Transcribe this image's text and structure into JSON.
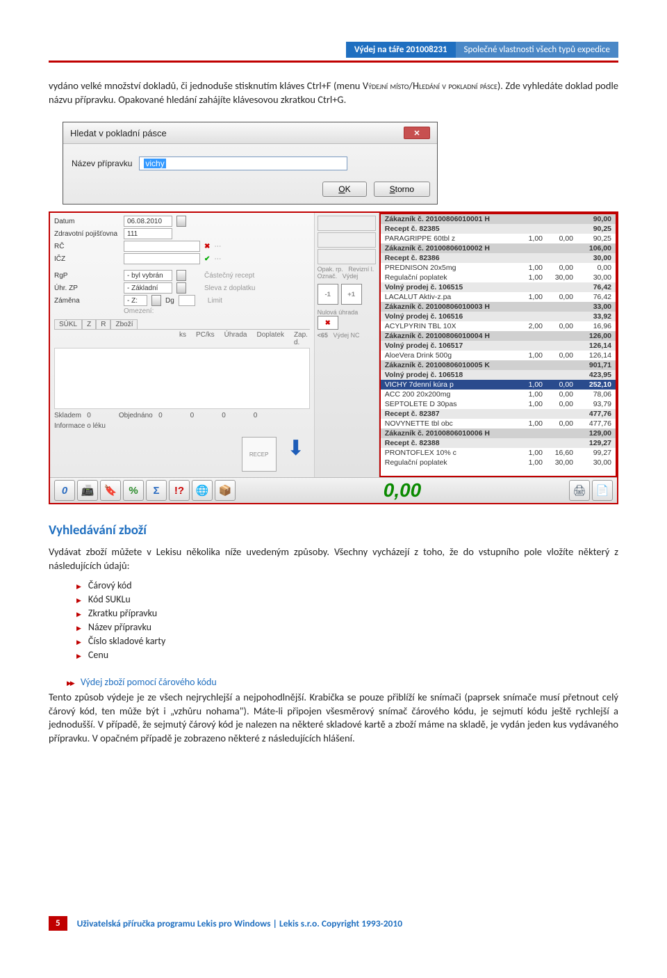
{
  "header": {
    "tag": "Výdej na táře 201008231",
    "sub": "Společné vlastnosti všech typů expedice"
  },
  "para1_a": "vydáno velké množství dokladů, či jednoduše stisknutím kláves Ctrl+F (menu ",
  "para1_sc": "Výdejní místo/Hledání v pokladní pásce",
  "para1_b": "). Zde vyhledáte doklad podle názvu přípravku. Opakované hledání zahájíte klávesovou zkratkou Ctrl+G.",
  "dialog": {
    "title": "Hledat v pokladní pásce",
    "label": "Název přípravku",
    "value": "vichy",
    "ok": "OK",
    "cancel": "Storno"
  },
  "pos": {
    "left": {
      "datum_lbl": "Datum",
      "datum_val": "06.08.2010",
      "zp_lbl": "Zdravotní pojišťovna",
      "zp_val": "111",
      "rc_lbl": "RČ",
      "icz_lbl": "IČZ",
      "rgp_lbl": "RgP",
      "rgp_val": "- byl vybrán",
      "uhr_lbl": "Úhr. ZP",
      "uhr_val": "- Základní",
      "zam_lbl": "Záměna",
      "zam_val": "- Z:",
      "dg_lbl": "Dg",
      "rec_lbl": "Částečný recept",
      "opak_lbl": "Opak. rp.",
      "rev_lbl": "Revizní l.",
      "sleva_lbl": "Sleva z doplatku",
      "ozn_lbl": "Označ.",
      "vyd_lbl": "Výdej",
      "limit_lbl": "Limit",
      "nul_lbl": "Nulová úhrada",
      "omez_lbl": "Omezení:",
      "lt65": "<65",
      "ncv": "Výdej NC",
      "tab_sukl": "SÚKL",
      "tab_z": "Z",
      "tab_r": "R",
      "tab_zbozi": "Zboží",
      "col_ks": "ks",
      "col_pcks": "PC/ks",
      "col_uhr": "Úhrada",
      "col_dop": "Doplatek",
      "col_zap": "Zap. d.",
      "skl_lbl": "Skladem",
      "skl_v": "0",
      "obj_lbl": "Objednáno",
      "obj_v": "0",
      "info_lbl": "Informace o léku",
      "z1": "0",
      "z2": "0",
      "z3": "0"
    },
    "right_rows": [
      {
        "t": "hdr",
        "name": "Zákazník č. 20100806010001 H",
        "amt": "90,00"
      },
      {
        "t": "sub",
        "name": "Recept č. 82385",
        "amt": "90,25"
      },
      {
        "t": "row",
        "name": "PARAGRIPPE 60tbl z",
        "c": "1,00",
        "c2": "0,00",
        "amt": "90,25"
      },
      {
        "t": "hdr",
        "name": "Zákazník č. 20100806010002 H",
        "amt": "106,00"
      },
      {
        "t": "sub",
        "name": "Recept č. 82386",
        "amt": "30,00"
      },
      {
        "t": "row",
        "name": "PREDNISON 20x5mg",
        "c": "1,00",
        "c2": "0,00",
        "amt": "0,00"
      },
      {
        "t": "row",
        "name": "Regulační poplatek",
        "c": "1,00",
        "c2": "30,00",
        "amt": "30,00"
      },
      {
        "t": "sub",
        "name": "Volný prodej č. 106515",
        "amt": "76,42"
      },
      {
        "t": "row",
        "name": "LACALUT Aktiv-z.pa",
        "c": "1,00",
        "c2": "0,00",
        "amt": "76,42"
      },
      {
        "t": "hdr",
        "name": "Zákazník č. 20100806010003 H",
        "amt": "33,00"
      },
      {
        "t": "sub",
        "name": "Volný prodej č. 106516",
        "amt": "33,92"
      },
      {
        "t": "row",
        "name": "ACYLPYRIN TBL 10X",
        "c": "2,00",
        "c2": "0,00",
        "amt": "16,96"
      },
      {
        "t": "hdr",
        "name": "Zákazník č. 20100806010004 H",
        "amt": "126,00"
      },
      {
        "t": "sub",
        "name": "Volný prodej č. 106517",
        "amt": "126,14"
      },
      {
        "t": "row",
        "name": "AloeVera Drink 500g",
        "c": "1,00",
        "c2": "0,00",
        "amt": "126,14"
      },
      {
        "t": "hdr",
        "name": "Zákazník č. 20100806010005 K",
        "amt": "901,71"
      },
      {
        "t": "sub",
        "name": "Volný prodej č. 106518",
        "amt": "423,95"
      },
      {
        "t": "sel",
        "name": "VICHY 7denní kúra p",
        "c": "1,00",
        "c2": "0,00",
        "amt": "252,10"
      },
      {
        "t": "row",
        "name": "ACC 200 20x200mg",
        "c": "1,00",
        "c2": "0,00",
        "amt": "78,06"
      },
      {
        "t": "row",
        "name": "SEPTOLETE D 30pas",
        "c": "1,00",
        "c2": "0,00",
        "amt": "93,79"
      },
      {
        "t": "sub",
        "name": "Recept č. 82387",
        "amt": "477,76"
      },
      {
        "t": "row",
        "name": "NOVYNETTE tbl obc",
        "c": "1,00",
        "c2": "0,00",
        "amt": "477,76"
      },
      {
        "t": "hdr",
        "name": "Zákazník č. 20100806010006 H",
        "amt": "129,00"
      },
      {
        "t": "sub",
        "name": "Recept č. 82388",
        "amt": "129,27"
      },
      {
        "t": "row",
        "name": "PRONTOFLEX 10% c",
        "c": "1,00",
        "c2": "16,60",
        "amt": "99,27"
      },
      {
        "t": "row",
        "name": "Regulační poplatek",
        "c": "1,00",
        "c2": "30,00",
        "amt": "30,00"
      }
    ],
    "total": "0,00",
    "minus1": "-1",
    "plus1": "+1"
  },
  "h2": "Vyhledávání zboží",
  "para2": "Vydávat zboží můžete v Lekisu několika níže uvedeným způsoby. Všechny vycházejí z toho, že do vstupního pole vložíte některý z následujících údajů:",
  "list": [
    "Čárový kód",
    "Kód SUKLu",
    "Zkratku přípravku",
    "Název přípravku",
    "Číslo skladové karty",
    "Cenu"
  ],
  "sub_h": "Výdej zboží pomocí čárového kódu",
  "para3": "Tento způsob výdeje je ze všech nejrychlejší a nejpohodlnější. Krabička se pouze přiblíží ke snímači (paprsek snímače musí přetnout celý čárový kód, ten může být i „vzhůru nohama\"). Máte-li připojen všesměrový snímač čárového kódu, je sejmutí kódu ještě rychlejší a jednodušší. V případě, že sejmutý čárový kód je nalezen na některé skladové kartě a zboží máme na skladě, je vydán jeden kus vydávaného přípravku. V opačném případě je zobrazeno některé z následujících hlášení.",
  "footer": {
    "page": "5",
    "text": "Uživatelská příručka programu Lekis pro Windows | Lekis s.r.o. Copyright 1993-2010"
  }
}
